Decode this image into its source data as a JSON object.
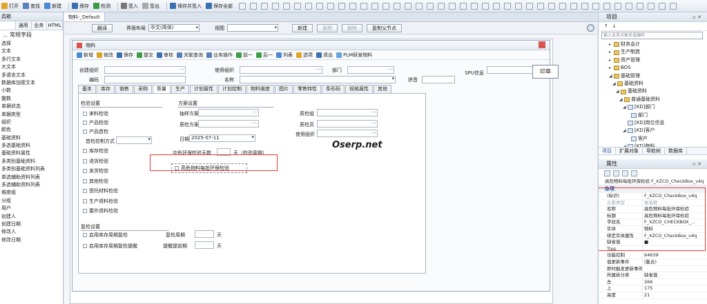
{
  "toolbar": {
    "items": [
      {
        "label": "打开",
        "icon": "folder-open-icon",
        "color": "#e0a526"
      },
      {
        "label": "查找",
        "icon": "search-icon",
        "color": "#5a7fb8"
      },
      {
        "label": "新建",
        "icon": "new-doc-icon",
        "color": "#4a8ad4"
      },
      {
        "label": "保存",
        "icon": "save-icon",
        "color": "#3a6fb0"
      },
      {
        "label": "检测",
        "icon": "check-icon",
        "color": "#3f9a4a"
      },
      {
        "label": "签入",
        "icon": "checkin-icon",
        "color": "#777777"
      },
      {
        "label": "签出",
        "icon": "checkout-icon",
        "color": "#aaaaaa"
      },
      {
        "label": "保存并签入",
        "icon": "save-checkin-icon",
        "color": "#3a6fb0"
      },
      {
        "label": "保存全部",
        "icon": "save-all-icon",
        "color": "#3a6fb0"
      }
    ]
  },
  "left_panel": {
    "title": "具箱",
    "tabs": [
      "",
      "通用",
      "业务",
      "HTML"
    ],
    "group": "常规字段",
    "items": [
      "选择",
      "文本",
      "多行文本",
      "大文本",
      "多语言文本",
      "数据库加密文本",
      "小数",
      "整数",
      "单据状态",
      "单据类型",
      "组织",
      "颜色",
      "基础资料",
      "多选基础资料",
      "基础资料属性",
      "多类别基础资料",
      "多类别基础资料列表",
      "单选辅助资料列表",
      "多选辅助资料列表",
      "维度组",
      "分组",
      "用户",
      "创建人",
      "创建日期",
      "修改人",
      "修改日期"
    ]
  },
  "document_tab": "物料-_Default",
  "property_bar": {
    "translate": "翻译",
    "layout_label": "界面布局",
    "layout_value": "中文(简体)",
    "view_label": "视图",
    "view_value": "",
    "new_btn": "新建",
    "copy_btn": "复制",
    "delete_btn": "删除",
    "copy_parent_btn": "复制父节点"
  },
  "form": {
    "title": "物料",
    "tools": [
      "新增",
      "修改",
      "保存",
      "提交",
      "审核",
      "关联查询",
      "业务操作",
      "前一",
      "后一",
      "列表",
      "选项",
      "退出",
      "PLM研发物料"
    ],
    "header_fields": {
      "create_org": "创建组织",
      "use_org": "使用组织",
      "dept": "部门",
      "spu": "SPU信息",
      "code": "编码",
      "name": "名称",
      "pinyin": "拼音",
      "stamp": "印章"
    },
    "tabs": [
      "基本",
      "库存",
      "销售",
      "采购",
      "质量",
      "生产",
      "计划属性",
      "计划控制",
      "物料维度",
      "图片",
      "零售特性",
      "条形码",
      "规格属性",
      "其他"
    ],
    "active_tab": "质量",
    "inspection": {
      "title": "检验设置",
      "items": [
        "来料检验",
        "产品检验",
        "产品首检"
      ],
      "first_ctrl_label": "首检控制方式",
      "items2": [
        "库存检验",
        "退货检验",
        "发货检验",
        "其他检验",
        "受托材料检验",
        "生产退料检验",
        "委外退料检验"
      ]
    },
    "plan": {
      "title": "方案设置",
      "sample_label": "抽样方案",
      "check_label": "质检方案",
      "date_label": "日期",
      "date_value": "2025-07-11",
      "qc_group": "质检组",
      "qc_staff": "质检员",
      "use_org": "使用组织",
      "days_label": "中危环保检验天数",
      "days_unit": "天（检验周期）",
      "highlight_checkbox": "高危物料每批环保检验"
    },
    "recheck": {
      "title": "复检设置",
      "item1": "启用库存周期复检",
      "item2": "启用库存周期复检提醒",
      "cycle_label": "复检周期",
      "remind_label": "提醒提前期",
      "unit": "天"
    },
    "watermark": "Oserp.net"
  },
  "project_pane": {
    "title": "项目",
    "search_placeholder": "输入业务对象名或编码",
    "tree": [
      {
        "level": 1,
        "label": "财务会计",
        "toggle": "▸",
        "folder": true
      },
      {
        "level": 1,
        "label": "生产制造",
        "toggle": "▸",
        "folder": true
      },
      {
        "level": 1,
        "label": "资产管理",
        "toggle": "▸",
        "folder": true
      },
      {
        "level": 1,
        "label": "BOS",
        "toggle": "▸",
        "folder": true
      },
      {
        "level": 1,
        "label": "基础管理",
        "toggle": "◢",
        "folder": true
      },
      {
        "level": 2,
        "label": "基础资料",
        "toggle": "◢",
        "folder": true
      },
      {
        "level": 3,
        "label": "基础资料",
        "toggle": "◢",
        "folder": true
      },
      {
        "level": 4,
        "label": "普通基础资料",
        "toggle": "◢",
        "folder": true
      },
      {
        "level": 5,
        "label": "[KD]部门",
        "toggle": "◢",
        "folder": false
      },
      {
        "level": 6,
        "label": "部门",
        "toggle": "",
        "folder": false
      },
      {
        "level": 5,
        "label": "[KD]岗位信息",
        "toggle": "",
        "folder": false
      },
      {
        "level": 5,
        "label": "[KD]客户",
        "toggle": "◢",
        "folder": false
      },
      {
        "level": 6,
        "label": "客户",
        "toggle": "",
        "folder": false
      },
      {
        "level": 5,
        "label": "[KD]物料",
        "toggle": "◢",
        "folder": false
      }
    ],
    "tabs": [
      "项目",
      "扩展对象",
      "导航树",
      "数据库"
    ]
  },
  "property_pane": {
    "title": "属性",
    "object_name": "高危物料每批环保检验 F_XZCO_CheckBox_v4q",
    "category": "杂项",
    "rows": [
      {
        "k": "(标识)",
        "v": "F_XZCO_CheckBox_v4q",
        "grey": false
      },
      {
        "k": "元素类型",
        "v": "复选框",
        "grey": true
      },
      {
        "k": "名称",
        "v": "高危物料每批环保检验",
        "grey": false
      },
      {
        "k": "标题",
        "v": "高危物料每批环保检验",
        "grey": false
      },
      {
        "k": "字段名",
        "v": "F_XZCO_CHECKBOX_...",
        "grey": false
      },
      {
        "k": "实体",
        "v": "物料",
        "grey": false
      },
      {
        "k": "绑定实体属性",
        "v": "F_XZCO_CheckBox_v4q",
        "grey": false
      },
      {
        "k": "缺省值",
        "v": "■",
        "grey": false
      },
      {
        "k": "Tips",
        "v": "",
        "grey": false
      },
      {
        "k": "功能控制",
        "v": "64639",
        "grey": false
      },
      {
        "k": "值更新事件",
        "v": "(集合)",
        "grey": false
      },
      {
        "k": "即时触发更新事件",
        "v": "",
        "grey": false
      },
      {
        "k": "所属拆分表",
        "v": "缺省值",
        "grey": false
      },
      {
        "k": "左",
        "v": "266",
        "grey": false
      },
      {
        "k": "上",
        "v": "175",
        "grey": false
      },
      {
        "k": "高度",
        "v": "21",
        "grey": false
      }
    ]
  },
  "colors": {
    "highlight": "#e03a2f",
    "accent": "#1c4f9c"
  }
}
